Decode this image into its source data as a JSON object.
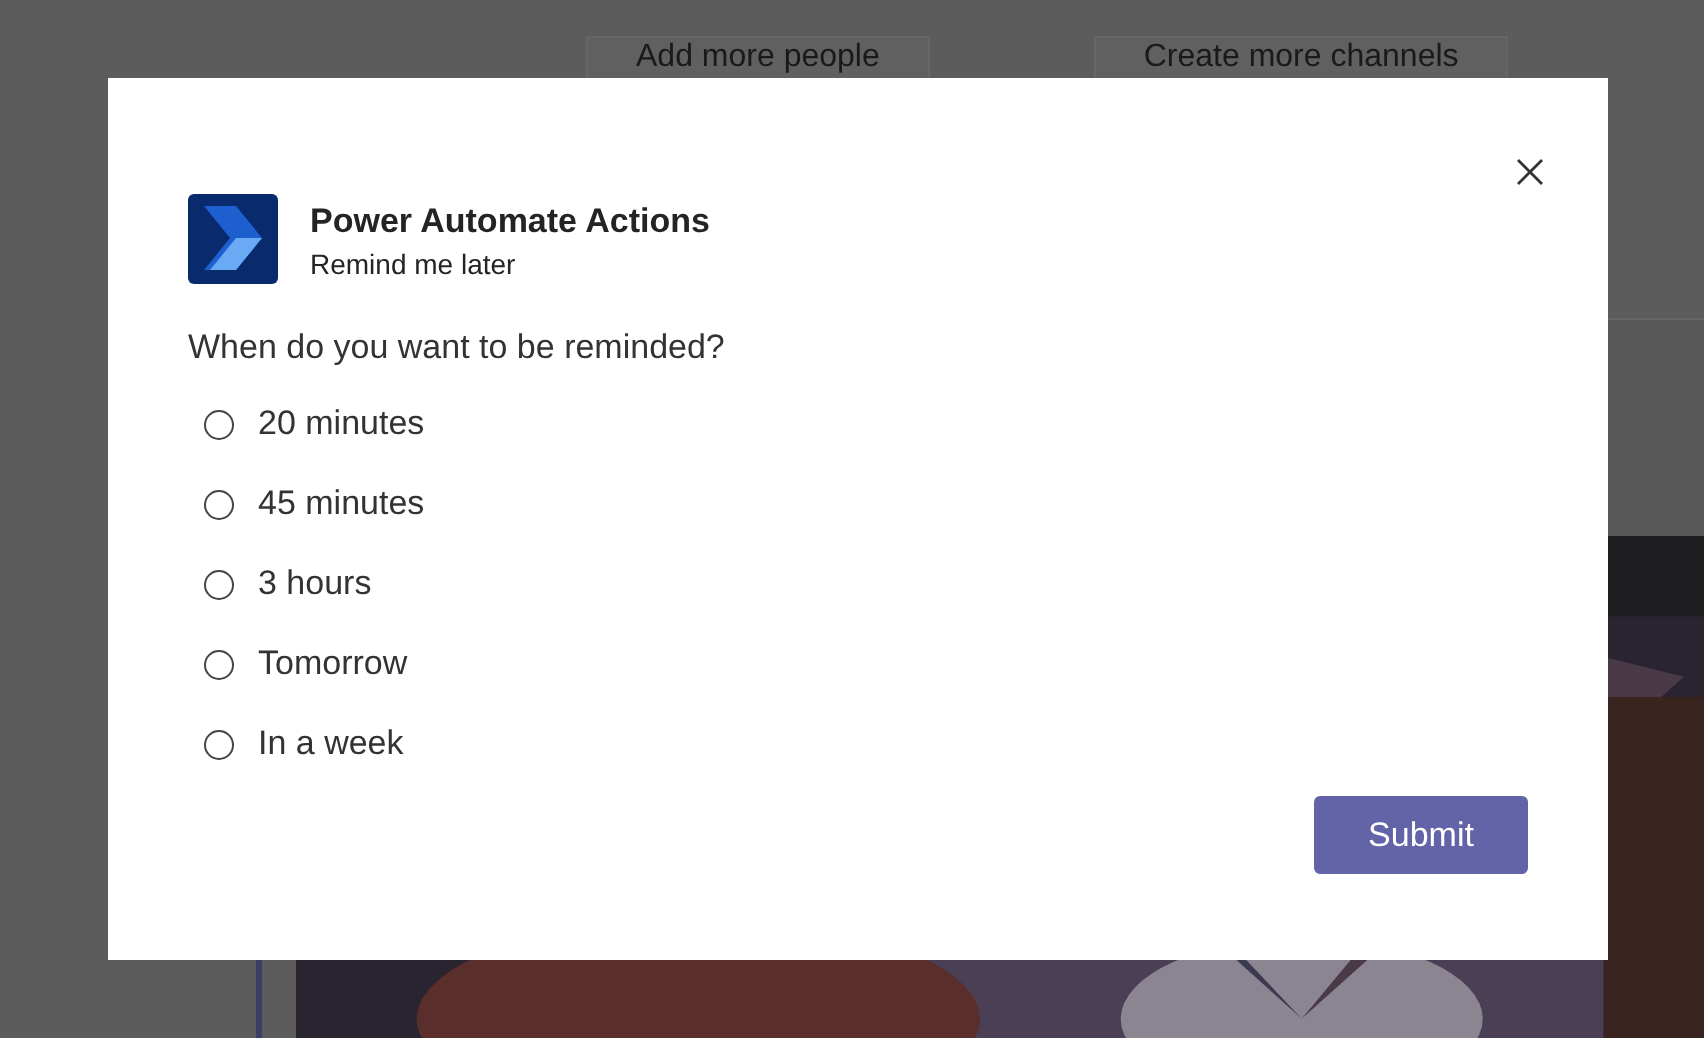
{
  "background": {
    "buttons": [
      "Add more people",
      "Create more channels"
    ]
  },
  "dialog": {
    "app_name": "Power Automate Actions",
    "subtitle": "Remind me later",
    "question": "When do you want to be reminded?",
    "options": [
      {
        "label": "20 minutes",
        "selected": false
      },
      {
        "label": "45 minutes",
        "selected": false
      },
      {
        "label": "3 hours",
        "selected": false
      },
      {
        "label": "Tomorrow",
        "selected": false
      },
      {
        "label": "In a week",
        "selected": false
      }
    ],
    "submit": "Submit"
  }
}
